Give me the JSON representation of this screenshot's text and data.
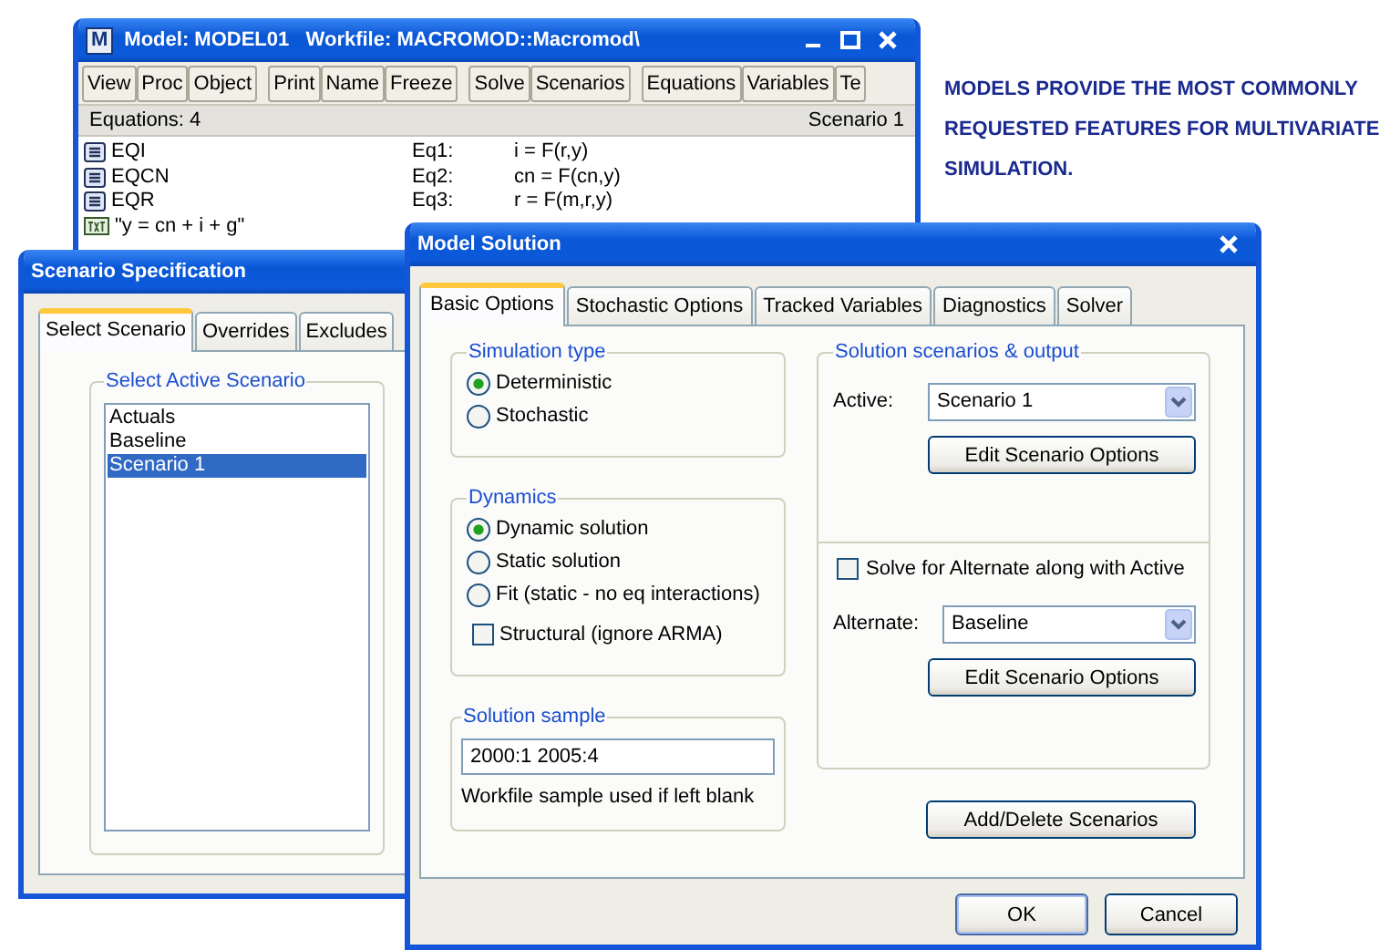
{
  "model_window": {
    "app_icon": "M",
    "title": "Model: MODEL01   Workfile: MACROMOD::Macromod\\",
    "toolbar": [
      [
        "View",
        "Proc",
        "Object"
      ],
      [
        "Print",
        "Name",
        "Freeze"
      ],
      [
        "Solve",
        "Scenarios"
      ],
      [
        "Equations",
        "Variables",
        "Te"
      ]
    ],
    "status_left": "Equations: 4",
    "status_right": "Scenario 1",
    "equations": [
      {
        "kind": "equation",
        "name": "EQI",
        "label": "Eq1:",
        "formula": "i = F(r,y)"
      },
      {
        "kind": "equation",
        "name": "EQCN",
        "label": "Eq2:",
        "formula": "cn = F(cn,y)"
      },
      {
        "kind": "equation",
        "name": "EQR",
        "label": "Eq3:",
        "formula": "r = F(m,r,y)"
      },
      {
        "kind": "text",
        "name": "\"y = cn + i + g\""
      }
    ]
  },
  "caption": "MODELS PROVIDE THE MOST COMMONLY REQUESTED FEATURES FOR MULTIVARIATE SIMULATION.",
  "scenario_window": {
    "title": "Scenario Specification",
    "tabs": [
      {
        "label": "Select Scenario",
        "selected": true
      },
      {
        "label": "Overrides",
        "selected": false
      },
      {
        "label": "Excludes",
        "selected": false
      }
    ],
    "group_label": "Select Active Scenario",
    "scenarios": [
      {
        "label": "Actuals",
        "selected": false
      },
      {
        "label": "Baseline",
        "selected": false
      },
      {
        "label": "Scenario 1",
        "selected": true
      }
    ]
  },
  "solution_window": {
    "title": "Model Solution",
    "tabs": [
      {
        "label": "Basic Options",
        "selected": true
      },
      {
        "label": "Stochastic Options",
        "selected": false
      },
      {
        "label": "Tracked Variables",
        "selected": false
      },
      {
        "label": "Diagnostics",
        "selected": false
      },
      {
        "label": "Solver",
        "selected": false
      }
    ],
    "simulation_type": {
      "label": "Simulation type",
      "options": [
        {
          "label": "Deterministic",
          "selected": true
        },
        {
          "label": "Stochastic",
          "selected": false
        }
      ]
    },
    "dynamics": {
      "label": "Dynamics",
      "options": [
        {
          "label": "Dynamic solution",
          "selected": true
        },
        {
          "label": "Static solution",
          "selected": false
        },
        {
          "label": "Fit (static - no eq interactions)",
          "selected": false
        }
      ],
      "structural": {
        "label": "Structural (ignore ARMA)",
        "checked": false
      }
    },
    "sample": {
      "label": "Solution sample",
      "value": "2000:1 2005:4",
      "hint": "Workfile sample used if left blank"
    },
    "scenarios": {
      "label": "Solution scenarios & output",
      "active_label": "Active:",
      "active_value": "Scenario 1",
      "active_button": "Edit Scenario Options",
      "alternate_check": {
        "label": "Solve for Alternate along with Active",
        "checked": false
      },
      "alternate_label": "Alternate:",
      "alternate_value": "Baseline",
      "alternate_button": "Edit Scenario Options"
    },
    "add_delete_button": "Add/Delete Scenarios",
    "buttons": [
      "OK",
      "Cancel"
    ]
  }
}
